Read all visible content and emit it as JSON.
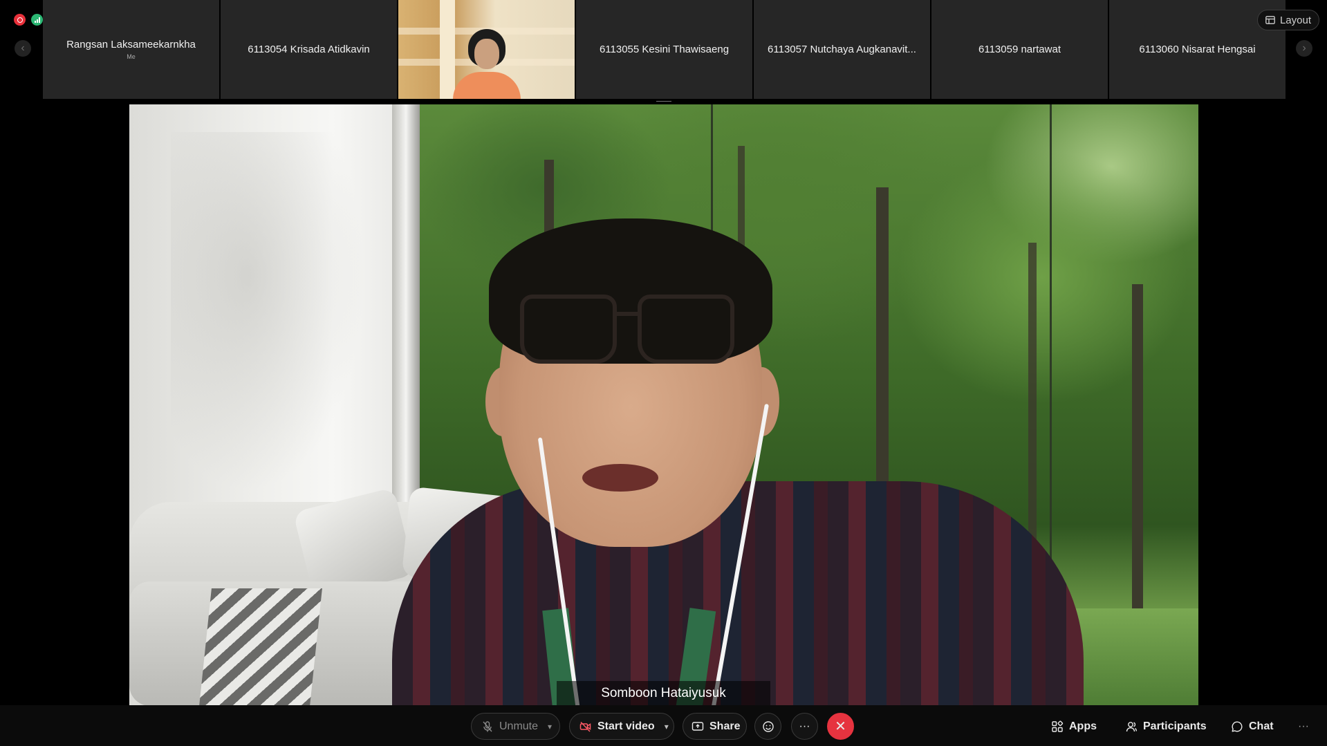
{
  "filmstrip": {
    "tiles": [
      {
        "name": "Rangsan Laksameekarnkha",
        "sub": "Me"
      },
      {
        "name": "6113054 Krisada Atidkavin"
      },
      {
        "name": ""
      },
      {
        "name": "6113055 Kesini Thawisaeng"
      },
      {
        "name": "6113057 Nutchaya Augkanavit..."
      },
      {
        "name": "6113059 nartawat"
      },
      {
        "name": "6113060 Nisarat Hengsai"
      }
    ],
    "prev_glyph": "‹",
    "next_glyph": "›"
  },
  "layout_button": {
    "label": "Layout",
    "icon": "layout-icon"
  },
  "stage": {
    "speaker_name": "Somboon Hataiyusuk"
  },
  "toolbar": {
    "unmute_label": "Unmute",
    "start_video_label": "Start video",
    "share_label": "Share",
    "more_glyph": "···",
    "leave_glyph": "✕",
    "apps_label": "Apps",
    "participants_label": "Participants",
    "chat_label": "Chat",
    "overflow_glyph": "···"
  },
  "colors": {
    "leave_red": "#e6333f",
    "recording_red": "#e8303a",
    "signal_green": "#2bb673"
  }
}
